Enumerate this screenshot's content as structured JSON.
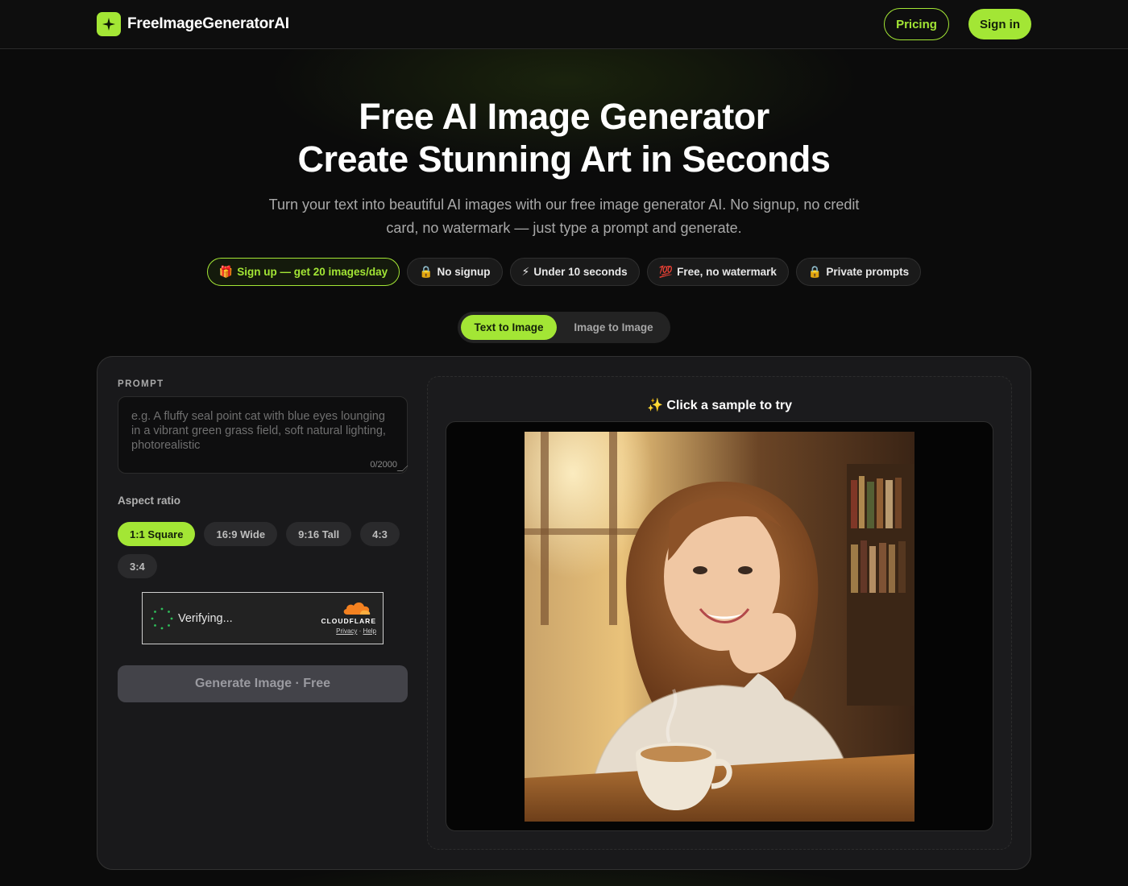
{
  "header": {
    "brand": "FreeImageGeneratorAI",
    "logo_icon": "sparkle-icon",
    "pricing_label": "Pricing",
    "signin_label": "Sign in"
  },
  "hero": {
    "title_line1": "Free AI Image Generator",
    "title_line2": "Create Stunning Art in Seconds",
    "subtitle": "Turn your text into beautiful AI images with our free image generator AI. No signup, no credit card, no watermark — just type a prompt and generate.",
    "badges": [
      {
        "emoji": "🎁",
        "label": "Sign up — get 20 images/day"
      },
      {
        "emoji": "🔒",
        "label": "No signup"
      },
      {
        "emoji": "⚡",
        "label": "Under 10 seconds"
      },
      {
        "emoji": "💯",
        "label": "Free, no watermark"
      },
      {
        "emoji": "🔒",
        "label": "Private prompts"
      }
    ]
  },
  "tabs": [
    {
      "label": "Text to Image",
      "active": true
    },
    {
      "label": "Image to Image",
      "active": false
    }
  ],
  "form": {
    "prompt_label": "PROMPT",
    "prompt_placeholder": "e.g. A fluffy seal point cat with blue eyes lounging in a vibrant green grass field, soft natural lighting, photorealistic",
    "prompt_counter": "0/2000",
    "aspect_label": "Aspect ratio",
    "ratios": [
      {
        "label": "1:1 Square",
        "active": true
      },
      {
        "label": "16:9 Wide",
        "active": false
      },
      {
        "label": "9:16 Tall",
        "active": false
      },
      {
        "label": "4:3",
        "active": false
      },
      {
        "label": "3:4",
        "active": false
      }
    ],
    "captcha": {
      "status": "Verifying...",
      "brand": "CLOUDFLARE",
      "privacy": "Privacy",
      "separator": "·",
      "help": "Help"
    },
    "generate_label": "Generate Image · Free"
  },
  "preview": {
    "title": "✨ Click a sample to try"
  },
  "colors": {
    "accent": "#a3e635",
    "background": "#0b0b0b",
    "panel": "#19191b"
  }
}
